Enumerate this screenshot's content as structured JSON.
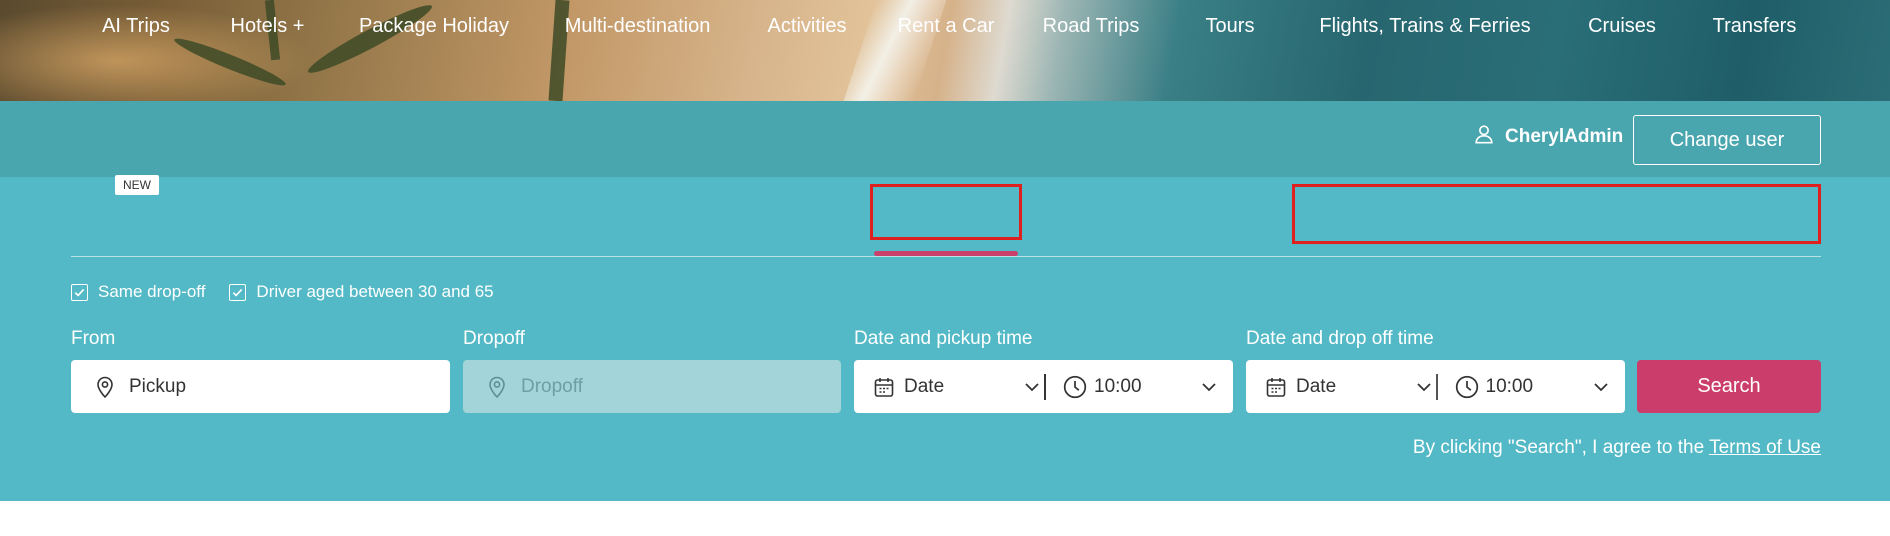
{
  "user": {
    "name": "CherylAdmin",
    "change_label": "Change user"
  },
  "tabs": [
    {
      "label": "AI Trips",
      "badge": "NEW"
    },
    {
      "label": "Hotels +"
    },
    {
      "label": "Package Holiday"
    },
    {
      "label": "Multi-destination"
    },
    {
      "label": "Activities"
    },
    {
      "label": "Rent a Car",
      "active": true
    },
    {
      "label": "Road Trips"
    },
    {
      "label": "Tours"
    },
    {
      "label": "Flights, Trains & Ferries"
    },
    {
      "label": "Cruises"
    },
    {
      "label": "Transfers"
    }
  ],
  "options": {
    "same_dropoff": "Same drop-off",
    "driver_age": "Driver aged between 30 and 65"
  },
  "form": {
    "from_label": "From",
    "from_placeholder": "Pickup",
    "dropoff_label": "Dropoff",
    "dropoff_placeholder": "Dropoff",
    "pickup_dt_label": "Date and pickup time",
    "dropoff_dt_label": "Date and drop off time",
    "date_placeholder": "Date",
    "pickup_time": "10:00",
    "dropoff_time": "10:00",
    "search_label": "Search"
  },
  "terms": {
    "text": "By clicking \"Search\", I agree to the ",
    "link": "Terms of Use"
  },
  "colors": {
    "accent": "#cb3e6b",
    "panel": "#53b9c6",
    "userbar": "#4aa6ae",
    "highlight": "#e01f1f"
  },
  "icons": {
    "user": "user-icon",
    "pin": "map-pin-icon",
    "calendar": "calendar-icon",
    "clock": "clock-icon",
    "chevron": "chevron-down-icon",
    "check": "checkmark-icon"
  }
}
